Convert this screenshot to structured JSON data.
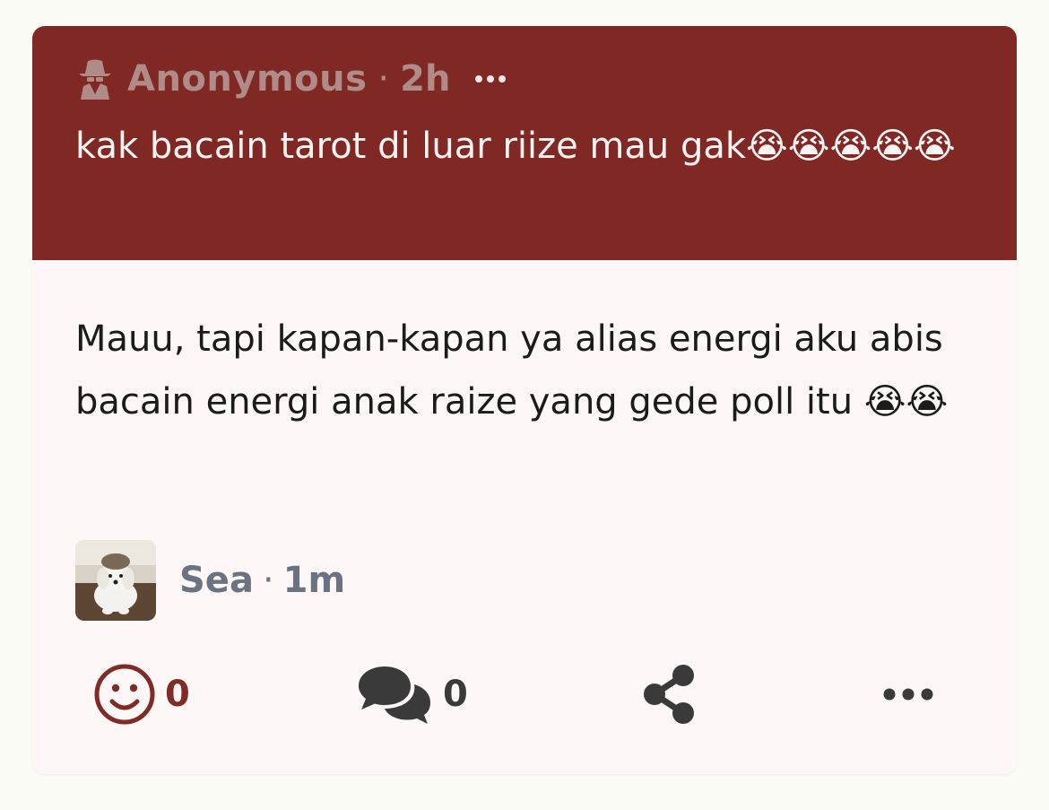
{
  "question": {
    "author": "Anonymous",
    "separator": "·",
    "time": "2h",
    "text": "kak bacain tarot di luar riize mau gak😭😭😭😭😭",
    "icons": {
      "author_icon": "spy-icon",
      "menu_icon": "more-horizontal-icon"
    }
  },
  "answer": {
    "text": "Mauu, tapi kapan-kapan ya alias energi aku abis bacain energi anak raize yang gede poll itu 😭😭"
  },
  "responder": {
    "name": "Sea",
    "separator": "·",
    "time": "1m",
    "avatar_icon": "dog-avatar"
  },
  "actions": {
    "reactions": {
      "count": "0",
      "icon": "smile-icon"
    },
    "comments": {
      "count": "0",
      "icon": "comments-icon"
    },
    "share": {
      "icon": "share-icon"
    },
    "more": {
      "icon": "more-horizontal-icon"
    }
  },
  "colors": {
    "question_bg": "#802924",
    "accent": "#7f2c27",
    "page_bg": "#fcfcf7",
    "card_bg": "#fdf8f7",
    "meta_text": "#6b7280"
  }
}
